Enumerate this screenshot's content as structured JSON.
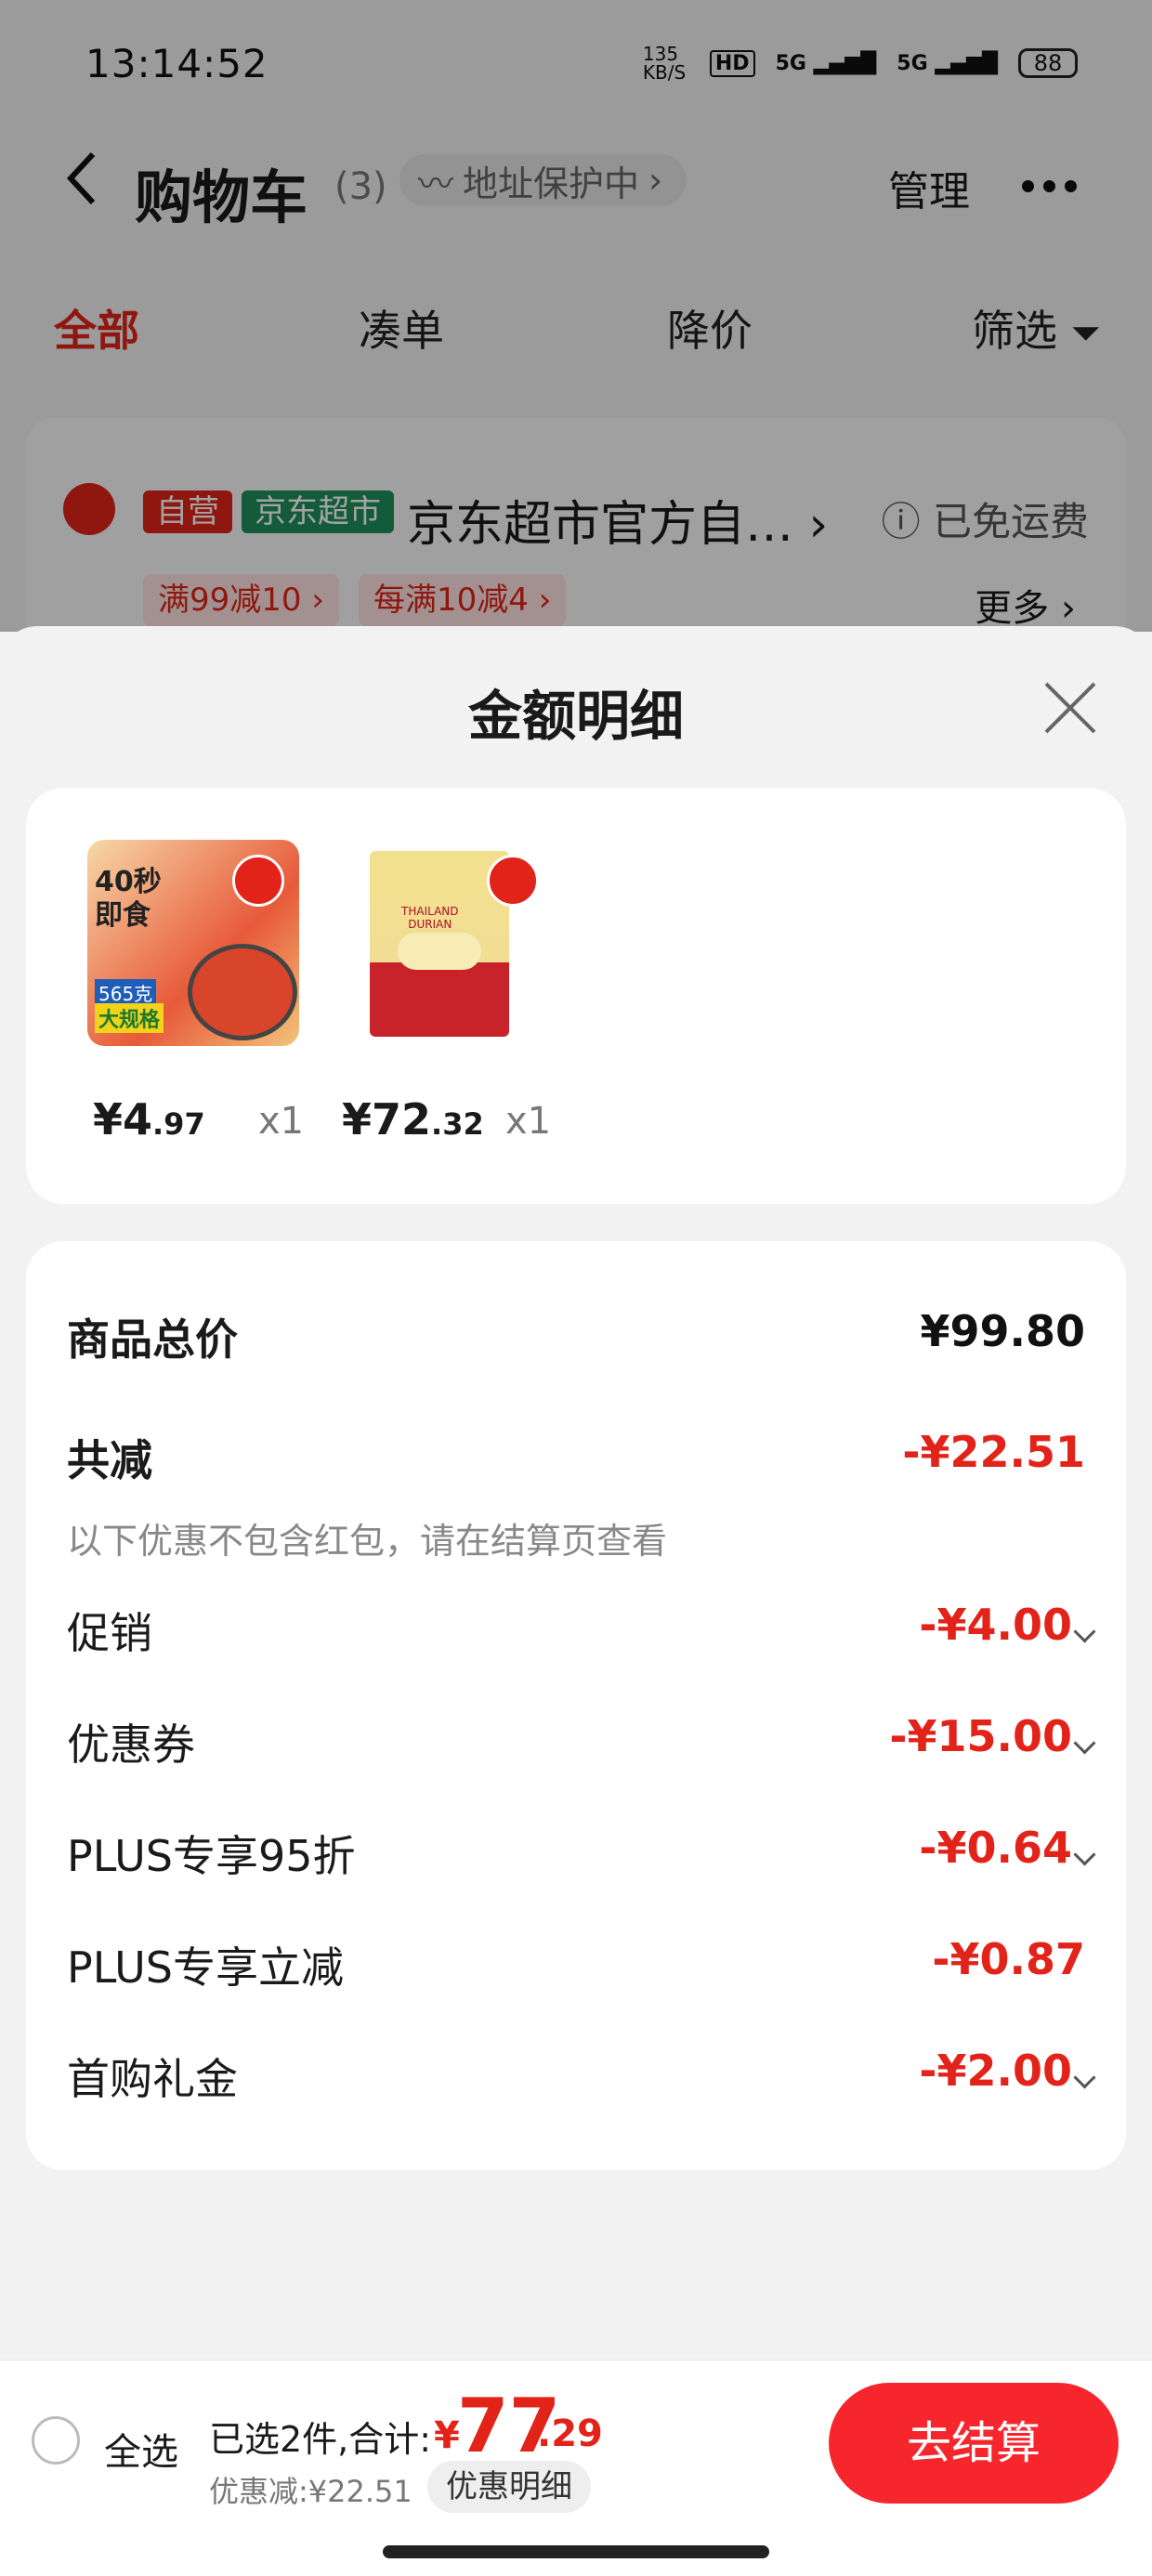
{
  "status_bar": {
    "time": "13:14:52",
    "net_speed": "135 KB/S",
    "hd": "HD",
    "signal1": "5G",
    "signal2": "5G",
    "battery": "88"
  },
  "header": {
    "title": "购物车",
    "count": "(3)",
    "address_protection": "地址保护中",
    "manage": "管理"
  },
  "tabs": [
    "全部",
    "凑单",
    "降价",
    "筛选"
  ],
  "store": {
    "tag_self": "自营",
    "tag_market": "京东超市",
    "name": "京东超市官方自…",
    "shipping": "已免运费",
    "promos": [
      "满99减10",
      "每满10减4"
    ],
    "more": "更多"
  },
  "modal": {
    "title": "金额明细",
    "products": [
      {
        "price_int": "¥4",
        "price_dec": ".97",
        "qty": "x1",
        "img_text": [
          "40秒",
          "即食",
          "565克",
          "大规格"
        ]
      },
      {
        "price_int": "¥72",
        "price_dec": ".32",
        "qty": "x1",
        "img_text": [
          "THAILAND",
          "DURIAN"
        ]
      }
    ],
    "summary": {
      "total_label": "商品总价",
      "total_value": "¥99.80",
      "reduce_label": "共减",
      "reduce_value": "-¥22.51",
      "note": "以下优惠不包含红包，请在结算页查看",
      "items": [
        {
          "label": "促销",
          "value": "-¥4.00"
        },
        {
          "label": "优惠券",
          "value": "-¥15.00"
        },
        {
          "label": "PLUS专享95折",
          "value": "-¥0.64"
        },
        {
          "label": "PLUS专享立减",
          "value": "-¥0.87"
        },
        {
          "label": "首购礼金",
          "value": "-¥2.00"
        }
      ]
    }
  },
  "bottom": {
    "select_all": "全选",
    "selected": "已选2件,合计:",
    "currency": "¥",
    "total_int": "77",
    "total_dec": ".29",
    "discount": "优惠减:¥22.51",
    "detail": "优惠明细",
    "checkout": "去结算"
  },
  "colors": {
    "accent": "#e2231a",
    "checkout": "#f7262d",
    "market_tag": "#1f8f5c"
  }
}
